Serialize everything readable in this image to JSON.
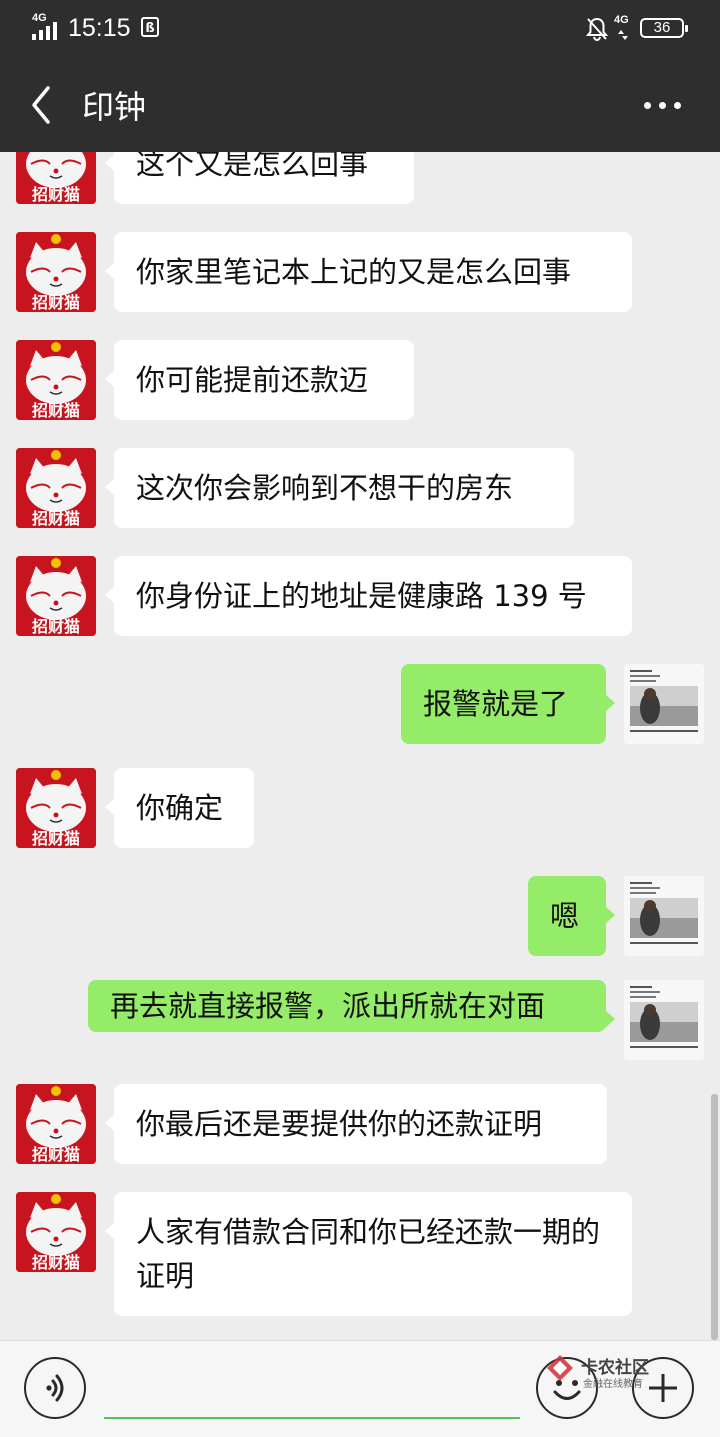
{
  "status_bar": {
    "network_left": "4G",
    "time": "15:15",
    "network_right": "4G",
    "battery": "36"
  },
  "header": {
    "title": "印钟"
  },
  "avatar_caption": "招财猫",
  "messages": [
    {
      "side": "in",
      "text": "这个又是怎么回事"
    },
    {
      "side": "in",
      "text": "你家里笔记本上记的又是怎么回事"
    },
    {
      "side": "in",
      "text": "你可能提前还款迈"
    },
    {
      "side": "in",
      "text": "这次你会影响到不想干的房东"
    },
    {
      "side": "in",
      "text": "你身份证上的地址是健康路 139 号"
    },
    {
      "side": "out",
      "text": "报警就是了"
    },
    {
      "side": "in",
      "text": "你确定"
    },
    {
      "side": "out",
      "text": "嗯"
    },
    {
      "side": "out",
      "text": "再去就直接报警，派出所就在对面"
    },
    {
      "side": "in",
      "text": "你最后还是要提供你的还款证明"
    },
    {
      "side": "in",
      "text": "人家有借款合同和你已经还款一期的证明"
    }
  ],
  "watermark": {
    "name": "卡农社区",
    "sub": "金融在线教育"
  },
  "colors": {
    "header_bg": "#2e2e2e",
    "chat_bg": "#ededed",
    "bubble_in": "#ffffff",
    "bubble_out": "#95ec69",
    "input_underline": "#56c058"
  },
  "icons": {
    "back": "chevron-left-icon",
    "more": "more-dots-icon",
    "voice": "voice-icon",
    "emoji": "emoji-icon",
    "plus": "plus-icon"
  }
}
